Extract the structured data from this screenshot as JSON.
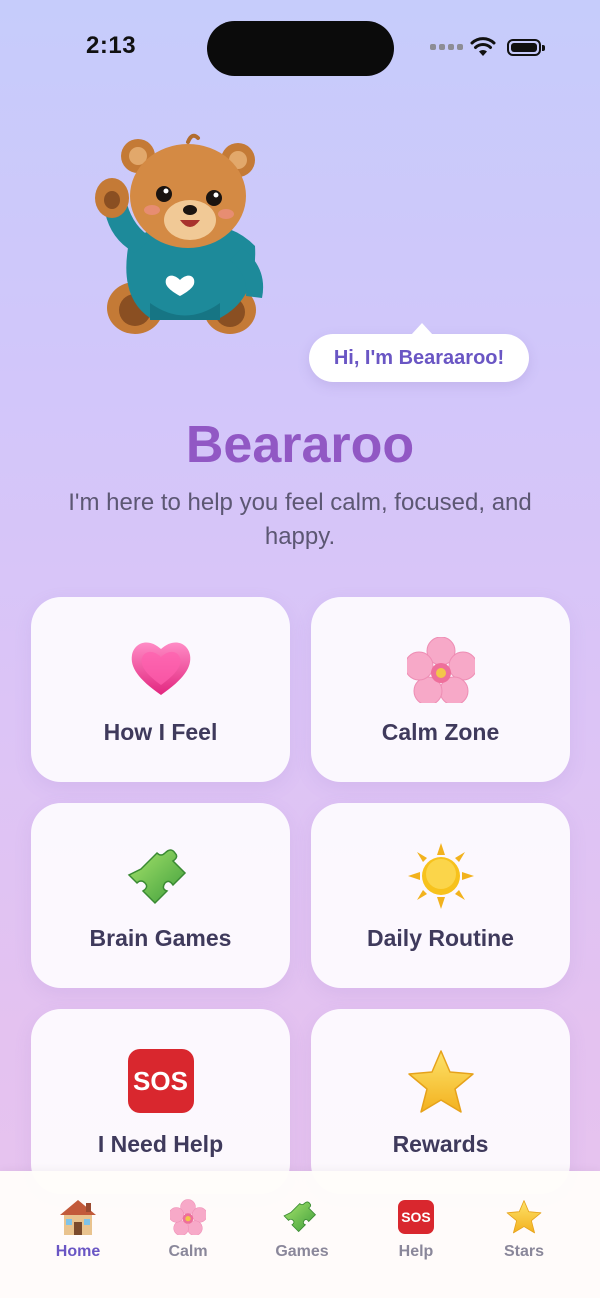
{
  "status_bar": {
    "time": "2:13"
  },
  "mascot": {
    "speech": "Hi, I'm Bearaaroo!"
  },
  "header": {
    "title": "Beararoo",
    "subtitle": "I'm here to help you feel calm, focused, and happy."
  },
  "cards": [
    {
      "label": "How I Feel",
      "icon": "heart-icon"
    },
    {
      "label": "Calm Zone",
      "icon": "flower-icon"
    },
    {
      "label": "Brain Games",
      "icon": "puzzle-icon"
    },
    {
      "label": "Daily Routine",
      "icon": "sun-icon"
    },
    {
      "label": "I Need Help",
      "icon": "sos-icon"
    },
    {
      "label": "Rewards",
      "icon": "star-icon"
    }
  ],
  "sos_text": "SOS",
  "tabs": [
    {
      "label": "Home",
      "icon": "house-icon",
      "active": true
    },
    {
      "label": "Calm",
      "icon": "flower-icon"
    },
    {
      "label": "Games",
      "icon": "puzzle-icon"
    },
    {
      "label": "Help",
      "icon": "sos-icon"
    },
    {
      "label": "Stars",
      "icon": "star-icon"
    }
  ],
  "colors": {
    "accent": "#6a56c4",
    "title": "#9158c4",
    "sos": "#d9272e"
  }
}
